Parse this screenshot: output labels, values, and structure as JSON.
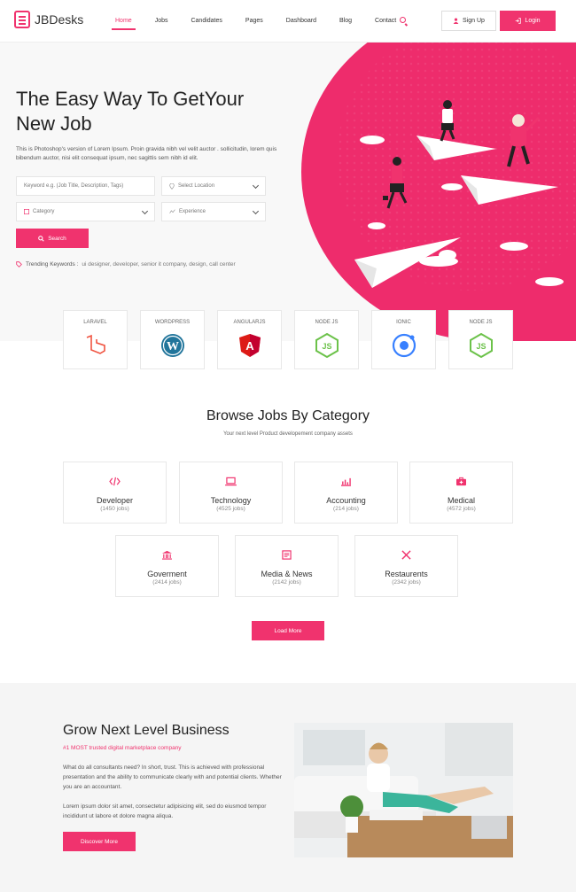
{
  "header": {
    "logo_text": "JBDesks",
    "nav": [
      "Home",
      "Jobs",
      "Candidates",
      "Pages",
      "Dashboard",
      "Blog",
      "Contact"
    ],
    "signup_label": "Sign Up",
    "login_label": "Login"
  },
  "hero": {
    "title_line1": "The Easy Way To GetYour",
    "title_line2": "New Job",
    "desc": "This is Photoshop's version of Lorem Ipsum. Proin gravida nibh vel velit auctor . sollicitudin, lorem quis bibendum auctor, nisi elit consequat ipsum, nec sagittis sem nibh id elit.",
    "keyword_placeholder": "Keyword e.g. (Job Title, Description, Tags)",
    "location_placeholder": "Select Location",
    "category_placeholder": "Category",
    "experience_placeholder": "Experience",
    "search_label": "Search",
    "trending_label": "Trending Keywords :",
    "trending_tags": "ui designer,  developer,  senior  it company,  design,  call center"
  },
  "tech": [
    {
      "label": "LARAVEL",
      "icon": "laravel-icon"
    },
    {
      "label": "WORDPRESS",
      "icon": "wordpress-icon"
    },
    {
      "label": "ANGULARJS",
      "icon": "angular-icon"
    },
    {
      "label": "NODE JS",
      "icon": "nodejs-icon"
    },
    {
      "label": "IONIC",
      "icon": "ionic-icon"
    },
    {
      "label": "NODE JS",
      "icon": "nodejs-icon"
    }
  ],
  "categories": {
    "title": "Browse Jobs By Category",
    "subtitle": "Your next level Product developement company assets",
    "items": [
      {
        "name": "Developer",
        "count": "(1450 jobs)"
      },
      {
        "name": "Technology",
        "count": "(4525 jobs)"
      },
      {
        "name": "Accounting",
        "count": "(214 jobs)"
      },
      {
        "name": "Medical",
        "count": "(4572 jobs)"
      },
      {
        "name": "Goverment",
        "count": "(2414 jobs)"
      },
      {
        "name": "Media & News",
        "count": "(2142 jobs)"
      },
      {
        "name": "Restaurents",
        "count": "(2342 jobs)"
      }
    ],
    "load_more": "Load More"
  },
  "business": {
    "title": "Grow Next Level Business",
    "subtitle": "#1 MOST trusted digital marketplace company",
    "p1": "What do all consultants need? In short, trust. This is achieved with professional presentation and the ability to communicate clearly with and potential clients. Whether you are an accountant.",
    "p2": "Lorem ipsum dolor sit amet, consectetur adipisicing elit, sed do eiusmod tempor incididunt ut labore et dolore magna aliqua.",
    "button": "Discover More"
  },
  "colors": {
    "accent": "#f0336e"
  }
}
